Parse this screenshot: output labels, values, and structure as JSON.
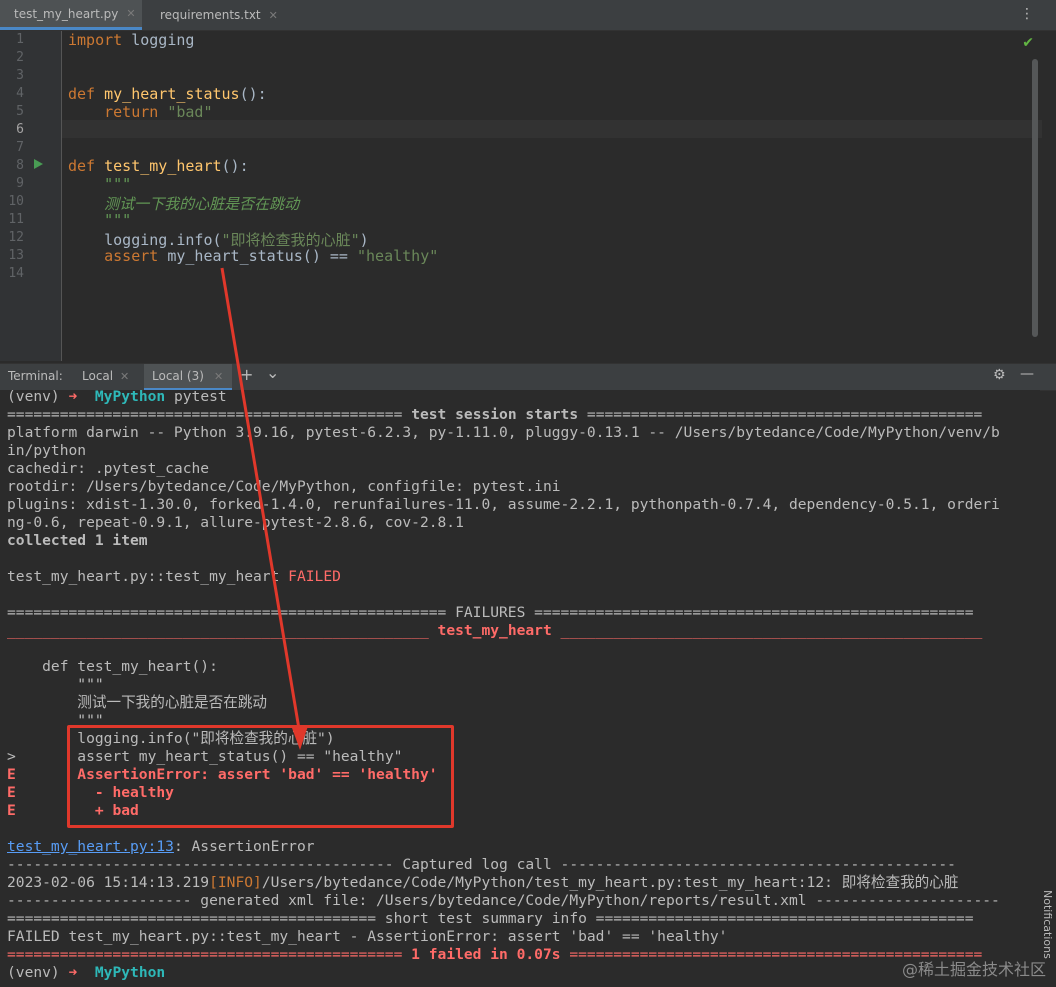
{
  "tabs": [
    {
      "label": "test_my_heart.py",
      "active": true
    },
    {
      "label": "requirements.txt",
      "active": false
    }
  ],
  "editor": {
    "line_numbers": [
      "1",
      "2",
      "3",
      "4",
      "5",
      "6",
      "7",
      "8",
      "9",
      "10",
      "11",
      "12",
      "13",
      "14"
    ],
    "code": {
      "l1_kw": "import",
      "l1_rest": " logging",
      "l4_kw": "def",
      "l4_fn": "my_heart_status",
      "l4_rest": "():",
      "l5_kw": "return",
      "l5_str": "\"bad\"",
      "l8_kw": "def",
      "l8_fn": "test_my_heart",
      "l8_rest": "():",
      "l9_doc": "\"\"\"",
      "l10_doc": "测试一下我的心脏是否在跳动",
      "l11_doc": "\"\"\"",
      "l12_pre": "logging.info(",
      "l12_str": "\"即将检查我的心脏\"",
      "l12_post": ")",
      "l13_kw": "assert",
      "l13_mid": " my_heart_status() == ",
      "l13_str": "\"healthy\""
    }
  },
  "terminal_bar": {
    "label": "Terminal:",
    "tab1": "Local",
    "tab2": "Local (3)",
    "add": "+",
    "chevron": "⌄"
  },
  "terminal": {
    "prompt_venv": "(venv)",
    "prompt_arrow": "➜",
    "prompt_dir": "MyPython",
    "cmd": "pytest",
    "session_sep_left": "=============================================",
    "session_title": "test session starts",
    "session_sep_right": "=============================================",
    "platform1": "platform darwin -- Python 3.9.16, pytest-6.2.3, py-1.11.0, pluggy-0.13.1 -- /Users/bytedance/Code/MyPython/venv/b",
    "platform2": "in/python",
    "cachedir": "cachedir: .pytest_cache",
    "rootdir": "rootdir: /Users/bytedance/Code/MyPython, configfile: pytest.ini",
    "plugins1": "plugins: xdist-1.30.0, forked-1.4.0, rerunfailures-11.0, assume-2.2.1, pythonpath-0.7.4, dependency-0.5.1, orderi",
    "plugins2": "ng-0.6, repeat-0.9.1, allure-pytest-2.8.6, cov-2.8.1",
    "collected": "collected 1 item",
    "result_test": "test_my_heart.py::test_my_heart ",
    "result_status": "FAILED",
    "failures_line": "================================================== FAILURES ==================================================",
    "fail_sep_left": "________________________________________________ ",
    "fail_title": "test_my_heart",
    "fail_sep_right": " ________________________________________________",
    "src1": "    def test_my_heart():",
    "src2": "        \"\"\"",
    "src3": "        测试一下我的心脏是否在跳动",
    "src4": "        \"\"\"",
    "src5": "        logging.info(\"即将检查我的心脏\")",
    "src6_marker": ">",
    "src6": "       assert my_heart_status() == \"healthy\"",
    "e_marker": "E",
    "e1": "       AssertionError: assert 'bad' == 'healthy'",
    "e2": "         - healthy",
    "e3": "         + bad",
    "loc_link": "test_my_heart.py:13",
    "loc_rest": ": AssertionError",
    "captured_line": "-------------------------------------------- Captured log call ---------------------------------------------",
    "log_time": "2023-02-06 15:14:13.219",
    "log_level": "[INFO]",
    "log_rest": "/Users/bytedance/Code/MyPython/test_my_heart.py:test_my_heart:12: 即将检查我的心脏",
    "xml_line": "--------------------- generated xml file: /Users/bytedance/Code/MyPython/reports/result.xml ---------------------",
    "summary_line": "========================================== short test summary info ===========================================",
    "summary_failed": "FAILED test_my_heart.py::test_my_heart - AssertionError: assert 'bad' == 'healthy'",
    "final_sep_left": "============================================= ",
    "final_text": "1 failed in 0.07s",
    "final_sep_right": " ==============================================="
  },
  "side": {
    "notifications": "Notifications"
  },
  "watermark": "@稀土掘金技术社区",
  "colors": {
    "accent": "#4a88c7",
    "fail": "#ff6b68",
    "prompt_dir": "#2eb8b8",
    "highlight_box": "#e0382b"
  }
}
